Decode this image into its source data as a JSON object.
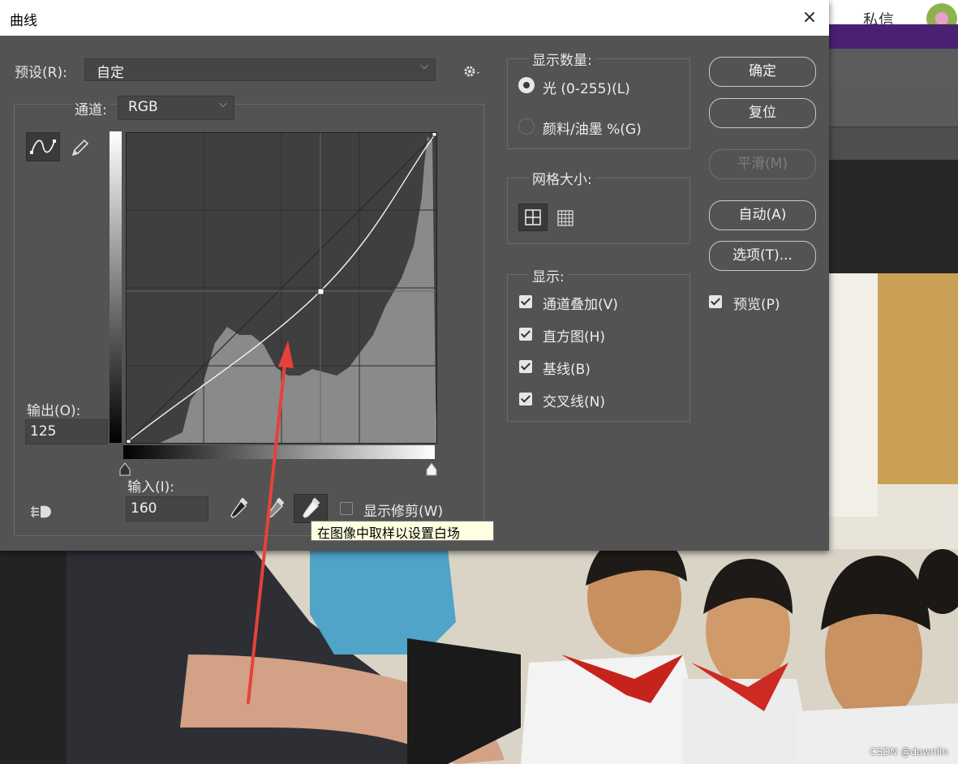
{
  "dialog": {
    "title": "曲线",
    "close_icon": "×",
    "preset": {
      "label": "预设(R):",
      "value": "自定"
    },
    "channel": {
      "label": "通道:",
      "value": "RGB"
    },
    "output": {
      "label": "输出(O):",
      "value": "125"
    },
    "input": {
      "label": "输入(I):",
      "value": "160"
    },
    "show_clipping_label": "显示修剪(W)",
    "tooltip": "在图像中取样以设置白场"
  },
  "display_amount": {
    "title": "显示数量:",
    "option_light": "光 (0-255)(L)",
    "option_pigment": "颜料/油墨 %(G)",
    "selected": "光 (0-255)(L)"
  },
  "grid_size": {
    "title": "网格大小:"
  },
  "show": {
    "title": "显示:",
    "items": [
      {
        "label": "通道叠加(V)",
        "checked": true
      },
      {
        "label": "直方图(H)",
        "checked": true
      },
      {
        "label": "基线(B)",
        "checked": true
      },
      {
        "label": "交叉线(N)",
        "checked": true
      }
    ]
  },
  "buttons": {
    "ok": "确定",
    "reset": "复位",
    "smooth": "平滑(M)",
    "auto": "自动(A)",
    "options": "选项(T)..."
  },
  "preview": {
    "label": "预览(P)",
    "checked": true
  },
  "background": {
    "message_label": "私信",
    "watermark": "CSDN @dawnlin"
  },
  "colors": {
    "dialog_bg": "#535353",
    "histogram": "#8a8a8a",
    "annotation_arrow": "#e8413a"
  }
}
